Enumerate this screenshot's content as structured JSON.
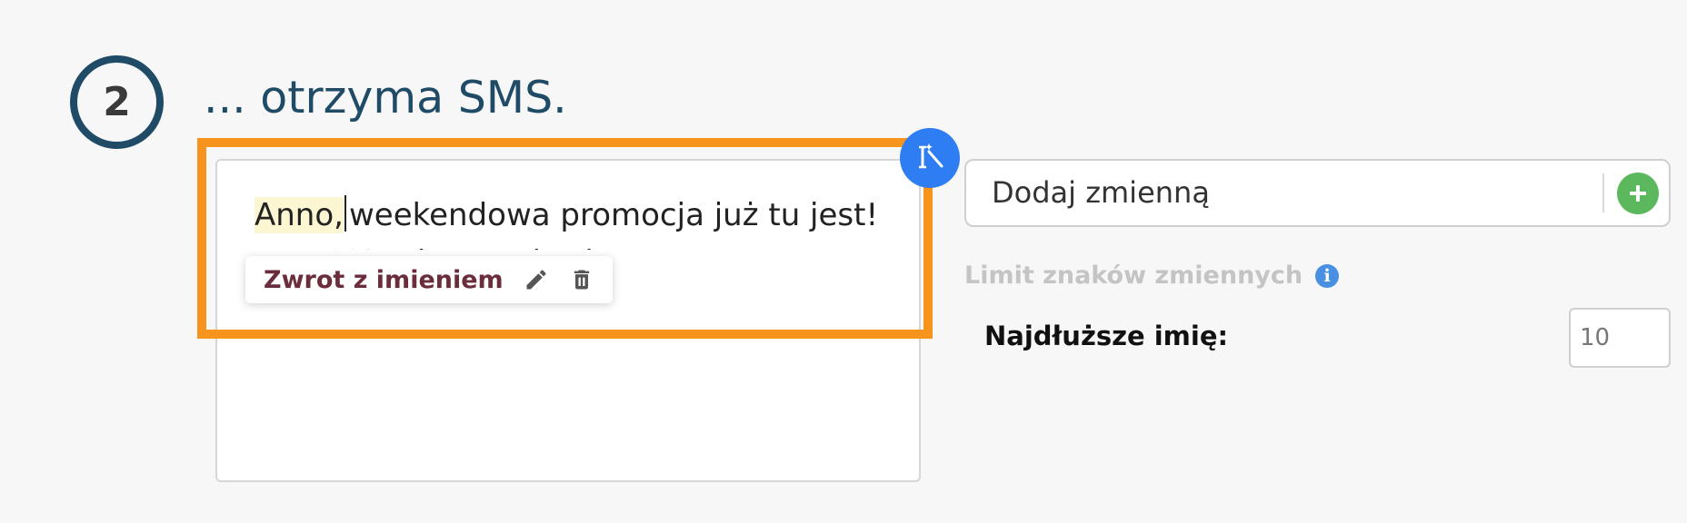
{
  "step": {
    "number": "2",
    "title": "... otrzyma SMS."
  },
  "editor": {
    "variable_text": "Anno,",
    "message_rest": "weekendowa promocja już tu jest! Do 40% rabatu w kasie!",
    "popover": {
      "label": "Zwrot z imieniem",
      "edit_icon": "pencil-icon",
      "delete_icon": "trash-icon"
    },
    "magic_icon": "magic-wand-icon"
  },
  "variables": {
    "add_placeholder": "Dodaj zmienną",
    "add_icon": "plus-icon",
    "limit_heading": "Limit znaków zmiennych",
    "info_icon": "info-icon",
    "longest_name_label": "Najdłuższe imię:",
    "longest_name_value": "10"
  },
  "colors": {
    "accent_dark": "#1f4b66",
    "highlight_frame": "#f7941d",
    "magic_button": "#2f7df2",
    "add_button": "#5cb85c",
    "variable_label": "#6b2d3c"
  }
}
